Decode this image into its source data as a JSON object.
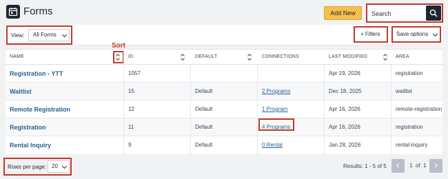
{
  "header": {
    "title": "Forms",
    "add_label": "Add New",
    "search_placeholder": "Search"
  },
  "toolbar": {
    "view_label": "View:",
    "view_value": "All Forms",
    "filters_label": "+ Filters",
    "save_label": "Save options"
  },
  "annotation": {
    "sort": "Sort"
  },
  "table": {
    "columns": [
      "NAME",
      "ID",
      "DEFAULT",
      "CONNECTIONS",
      "LAST MODIFIED",
      "AREA"
    ],
    "rows": [
      {
        "name": "Registration - YTT",
        "id": "1057",
        "default": "",
        "connections": "",
        "modified": "Apr 19, 2026",
        "area": "registration"
      },
      {
        "name": "Waitlist",
        "id": "15",
        "default": "Default",
        "connections": "2 Programs",
        "modified": "Dec 18, 2025",
        "area": "waitlist"
      },
      {
        "name": "Remote Registration",
        "id": "12",
        "default": "Default",
        "connections": "1 Program",
        "modified": "Apr 16, 2026",
        "area": "remote-registration"
      },
      {
        "name": "Registration",
        "id": "11",
        "default": "Default",
        "connections": "4 Programs",
        "modified": "Apr 16, 2026",
        "area": "registration"
      },
      {
        "name": "Rental Inquiry",
        "id": "9",
        "default": "Default",
        "connections": "0 Rental",
        "modified": "Jan 28, 2026",
        "area": "rental-inquiry"
      }
    ]
  },
  "footer": {
    "rows_per_page_label": "Rows per page:",
    "rows_per_page_value": "20",
    "results": "Results: 1 - 5 of 5",
    "page_current": "1",
    "page_of": "of",
    "page_total": "1"
  },
  "colors": {
    "accent": "#f6c04f",
    "link": "#2c5e8f",
    "highlight": "#c0392b",
    "dark": "#1e2430"
  }
}
